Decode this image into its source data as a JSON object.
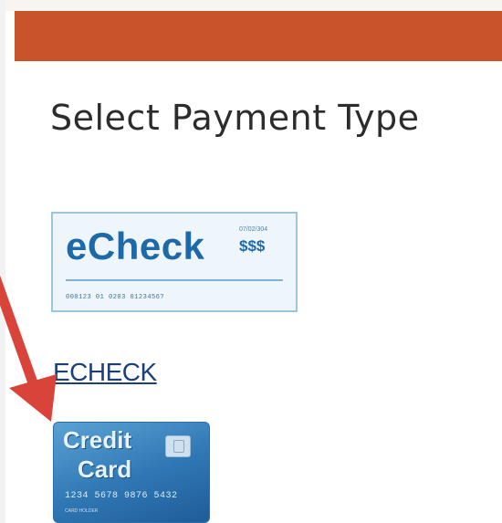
{
  "header": {
    "bar_color": "#c9542a"
  },
  "page": {
    "title": "Select Payment Type"
  },
  "payment_options": {
    "echeck": {
      "image": {
        "word": "eCheck",
        "date": "07/02/304",
        "amount": "$$$",
        "micr": "000123  01 0203  0123456?"
      },
      "link_label": "ECHECK"
    },
    "credit_card": {
      "image": {
        "word_line1": "Credit",
        "word_line2": "Card",
        "number": "1234 5678 9876 5432",
        "holder": "CARD HOLDER"
      }
    }
  },
  "annotation": {
    "arrow_color": "#d9443a"
  }
}
